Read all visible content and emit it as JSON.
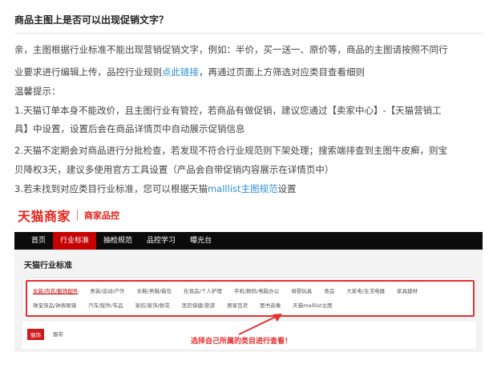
{
  "question": "商品主图上是否可以出现促销文字？",
  "answer": {
    "line1": "亲，主图根据行业标准不能出现营销促销文字，例如：半价，买一送一、原价等，商品的主图请按照不同行",
    "line2_before": "业要求进行编辑上传，品控行业规则",
    "line2_link": "点此链接",
    "line2_after": "，再通过页面上方筛选对应类目查看细则",
    "tips_title": "温馨提示：",
    "tip1_a": "1.天猫订单本身不能改价，且主图行业有管控，若商品有做促销，建议您通过【卖家中心】-【天猫营销工",
    "tip1_b": "具】中设置，设置后会在商品详情页中自动展示促销信息",
    "tip2_a": "2.天猫不定期会对商品进行分批检查，若发现不符合行业规范则下架处理；搜索端排查到主图牛皮癣，则宝",
    "tip2_b": "贝降权3天，建议多使用官方工具设置（产品会自带促销内容展示在详情页中）",
    "tip3_before": "3.若未找到对应类目行业标准，您可以根据天猫",
    "tip3_link": "malllist主图规范",
    "tip3_after": "设置"
  },
  "screenshot": {
    "brand_main": "天猫商家",
    "brand_sub": "商家品控",
    "nav": [
      "首页",
      "行业标准",
      "抽检规范",
      "品控学习",
      "曝光台"
    ],
    "nav_active_index": 1,
    "section_title": "天猫行业标准",
    "categories_row1": [
      "女装/内衣/服饰配件",
      "男装/运动/户外",
      "女鞋/男鞋/箱包",
      "化妆品/个人护理",
      "手机/数码/电脑办公",
      "母婴玩具",
      "食品",
      "大家电/生活电器",
      "家具建材"
    ],
    "categories_row2": [
      "珠宝饰品/钟表眼镜",
      "汽车/配件/车品",
      "家纺/家饰/鲜花",
      "医药保健/旅游",
      "居家百货",
      "图书音像",
      "天猫malllist主图"
    ],
    "sub_tags": [
      "服饰",
      "服带"
    ],
    "hint": "选择自己所属的类目进行查看！"
  },
  "colors": {
    "accent_red": "#e2231a",
    "link_blue": "#2e8fd6",
    "nav_black": "#0b0b0b"
  }
}
